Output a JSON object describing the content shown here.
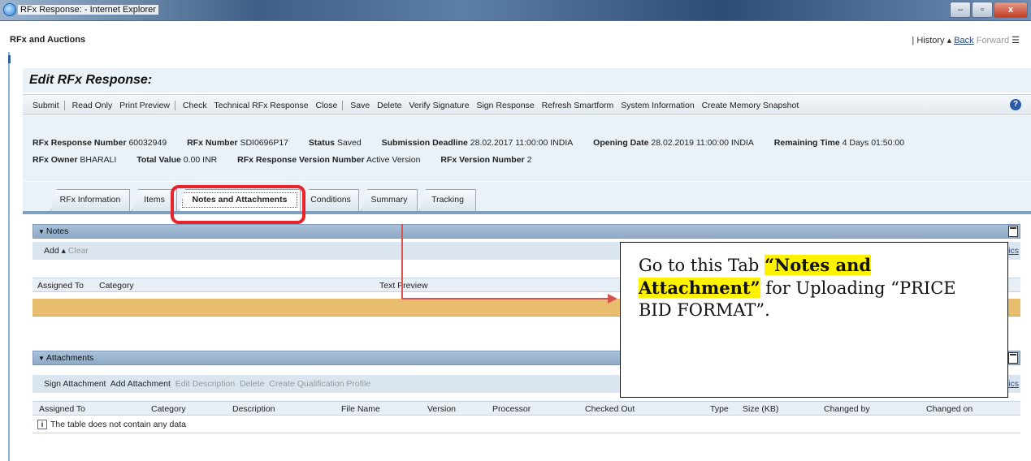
{
  "window": {
    "title": "RFx Response: - Internet Explorer",
    "buttons": [
      "–",
      "▫",
      "x"
    ]
  },
  "appbar": {
    "title": "RFx and Auctions",
    "history": "| History",
    "back": "Back",
    "forward": "Forward"
  },
  "page": {
    "heading": "Edit RFx Response:"
  },
  "toolbar": {
    "group1": [
      "Submit"
    ],
    "group2": [
      "Read Only",
      "Print Preview"
    ],
    "group3": [
      "Check",
      "Technical RFx Response",
      "Close"
    ],
    "group4": [
      "Save",
      "Delete",
      "Verify Signature",
      "Sign Response",
      "Refresh Smartform",
      "System Information",
      "Create Memory Snapshot"
    ]
  },
  "header": {
    "response_number_label": "RFx Response Number",
    "response_number": "60032949",
    "rfx_number_label": "RFx Number",
    "rfx_number": "SDI0696P17",
    "status_label": "Status",
    "status": "Saved",
    "deadline_label": "Submission Deadline",
    "deadline": "28.02.2017 11:00:00 INDIA",
    "opening_label": "Opening Date",
    "opening": "28.02.2019 11:00:00 INDIA",
    "remaining_label": "Remaining Time",
    "remaining": "4 Days 01:50:00",
    "owner_label": "RFx Owner",
    "owner": "BHARALI",
    "total_label": "Total Value",
    "total": "0.00 INR",
    "version_label": "RFx Response Version Number",
    "version": "Active Version",
    "rfx_version_label": "RFx Version Number",
    "rfx_version": "2"
  },
  "tabs": [
    "RFx Information",
    "Items",
    "Notes and Attachments",
    "Conditions",
    "Summary",
    "Tracking"
  ],
  "notes": {
    "title": "Notes",
    "add": "Add",
    "clear": "Clear",
    "settings_link": "ics",
    "columns": [
      "Assigned To",
      "Category",
      "Text Preview"
    ]
  },
  "attachments": {
    "title": "Attachments",
    "actions": [
      "Sign Attachment",
      "Add Attachment"
    ],
    "disabled_actions": [
      "Edit Description",
      "Delete",
      "Create Qualification Profile"
    ],
    "settings_link": "ics",
    "columns": [
      "Assigned To",
      "Category",
      "Description",
      "File Name",
      "Version",
      "Processor",
      "Checked Out",
      "Type",
      "Size (KB)",
      "Changed by",
      "Changed on"
    ],
    "empty": "The table does not contain any data"
  },
  "callout": {
    "prefix": "Go to this Tab ",
    "highlight1": "“Notes and",
    "highlight2": "Attachment”",
    "suffix": " for Uploading “PRICE BID FORMAT”."
  }
}
